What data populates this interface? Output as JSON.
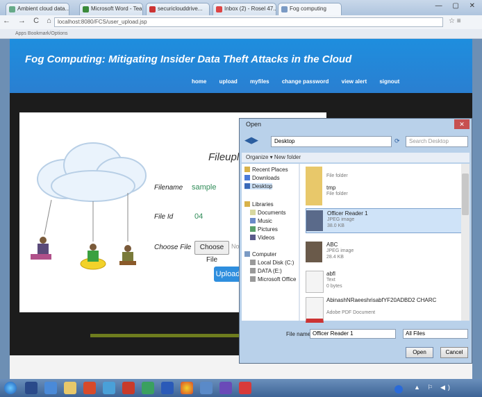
{
  "browser": {
    "tabs": [
      {
        "label": "Ambient cloud data..."
      },
      {
        "label": "Microsoft Word - Team..."
      },
      {
        "label": "securiclouddrive..."
      },
      {
        "label": "Inbox (2) - Rosel 47..."
      },
      {
        "label": "Fog computing"
      }
    ],
    "url": "localhost:8080/FCS/user_upload.jsp",
    "bookmark": "Apps Bookmark/Options"
  },
  "site": {
    "title": "Fog Computing: Mitigating Insider Data Theft Attacks in the Cloud",
    "nav": [
      "home",
      "upload",
      "myfiles",
      "change password",
      "view alert",
      "signout"
    ]
  },
  "form": {
    "heading": "Fileuplod",
    "filename_label": "Filename",
    "filename_value": "sample",
    "fileid_label": "File Id",
    "fileid_value": "04",
    "choose_label": "Choose File",
    "choose_button": "Choose File",
    "no_file": "No",
    "upload_button": "Upload"
  },
  "dialog": {
    "title": "Open",
    "path": "Desktop",
    "search_placeholder": "Search Desktop",
    "toolbar": "Organize ▾    New folder",
    "sidebar": [
      "Recent Places",
      "Downloads",
      "Desktop",
      "Libraries",
      "Documents",
      "Music",
      "Pictures",
      "Videos",
      "Computer",
      "Local Disk (C:)",
      "DATA (E:)",
      "Microsoft Office"
    ],
    "files": [
      {
        "name": "",
        "type": "File folder",
        "size": ""
      },
      {
        "name": "tmp",
        "type": "File folder",
        "size": ""
      },
      {
        "name": "Officer Reader 1",
        "type": "JPEG image",
        "size": "38.0 KB"
      },
      {
        "name": "ABC",
        "type": "JPEG image",
        "size": "28.4 KB"
      },
      {
        "name": "abfl",
        "type": "Text",
        "size": "0 bytes"
      },
      {
        "name": "AbinashNRaeeshrisabfYF20ADBD2 CHARC",
        "type": "Adobe PDF Document",
        "size": ""
      }
    ],
    "filename_label": "File name:",
    "filename_value": "Officer Reader 1",
    "type_value": "All Files",
    "open_button": "Open",
    "cancel_button": "Cancel"
  },
  "colors": {
    "header": "#1e8ede",
    "accent": "#2e8ede",
    "ground": "#6e7d1e"
  }
}
